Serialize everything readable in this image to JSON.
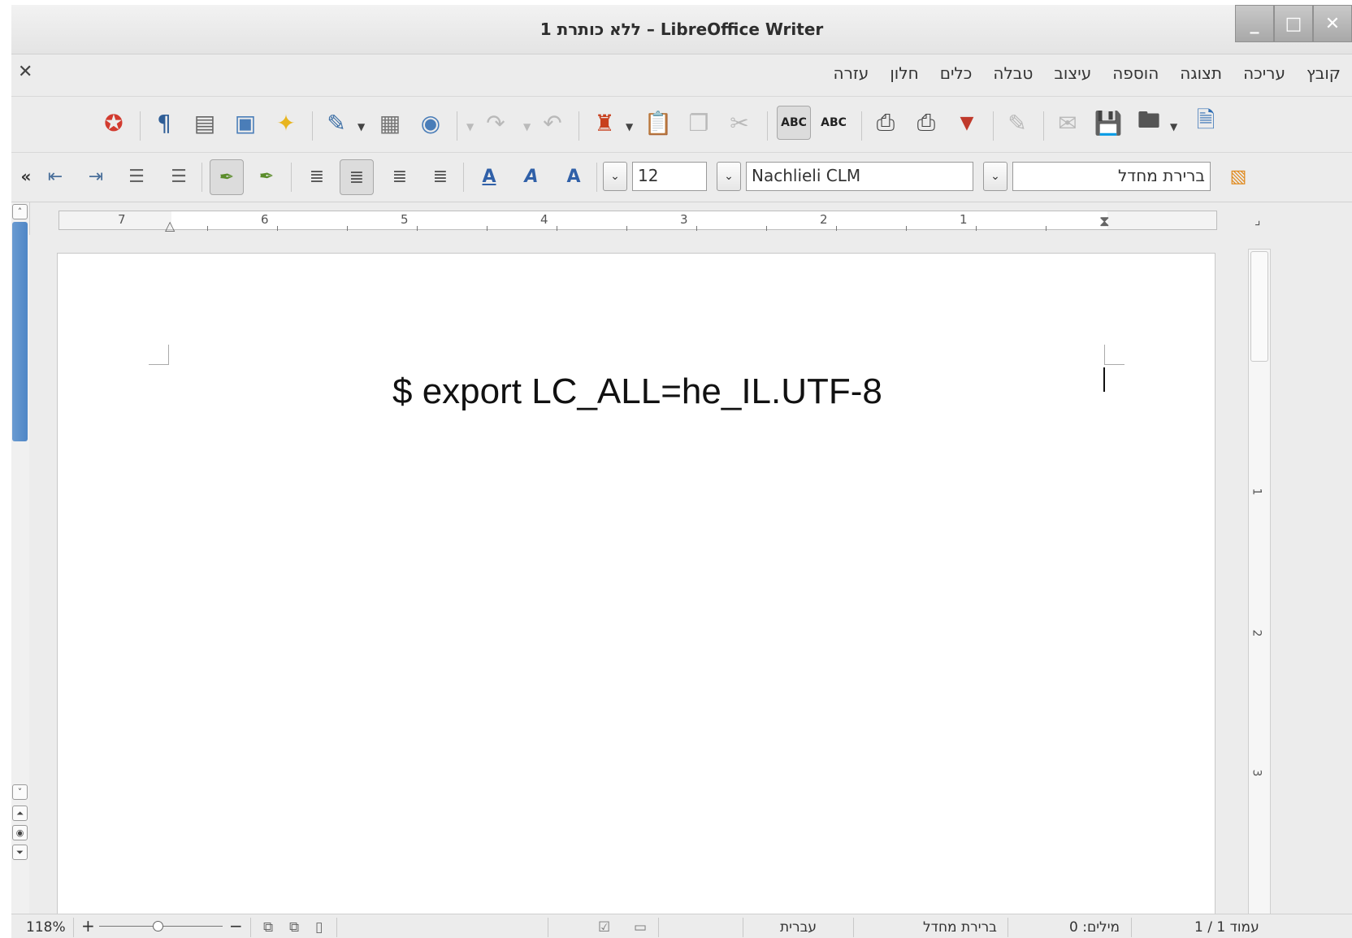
{
  "window": {
    "title": "ללא כותרת 1 – LibreOffice Writer"
  },
  "menu": {
    "items": [
      "קובץ",
      "עריכה",
      "תצוגה",
      "הוספה",
      "עיצוב",
      "טבלה",
      "כלים",
      "חלון",
      "עזרה"
    ]
  },
  "formatting": {
    "paragraph_style": "ברירת מחדל",
    "font_name": "Nachlieli CLM",
    "font_size": "12"
  },
  "ruler": {
    "labels": [
      "7",
      "6",
      "5",
      "4",
      "3",
      "2",
      "1"
    ]
  },
  "vertical_ruler": {
    "labels": [
      "1",
      "2",
      "3"
    ]
  },
  "document": {
    "text": "$ export LC_ALL=he_IL.UTF-8"
  },
  "status": {
    "page": "עמוד 1 / 1",
    "words": "מילים: 0",
    "page_style": "ברירת מחדל",
    "language": "עברית",
    "zoom": "118%"
  }
}
